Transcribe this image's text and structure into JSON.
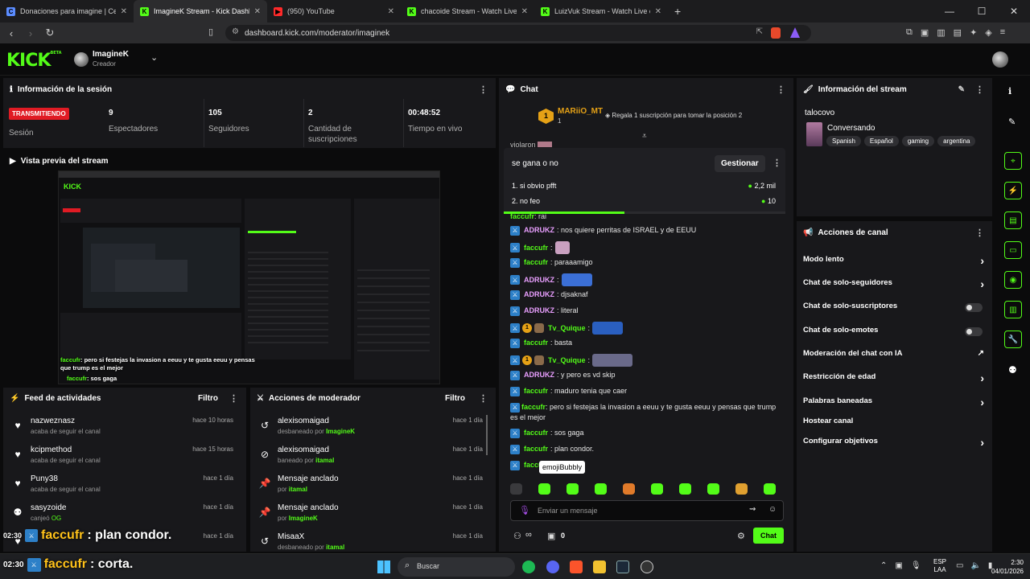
{
  "browser": {
    "tabs": [
      {
        "title": "Donaciones para imagine | Ceneka",
        "icon": "ceneka-icon",
        "color": "#5b8cff"
      },
      {
        "title": "ImagineK Stream - Kick Dashb",
        "icon": "kick-icon",
        "color": "#53fc18",
        "active": true
      },
      {
        "title": "(950) YouTube",
        "icon": "youtube-icon",
        "color": "#ff2a2a"
      },
      {
        "title": "chacoide Stream - Watch Live on",
        "icon": "kick-icon",
        "color": "#53fc18"
      },
      {
        "title": "LuizVuk Stream - Watch Live on",
        "icon": "kick-icon",
        "color": "#53fc18"
      }
    ],
    "new_tab": "+",
    "url": "dashboard.kick.com/moderator/imaginek"
  },
  "header": {
    "logo": "KICK",
    "logo_badge": "BETA",
    "channel_name": "ImagineK",
    "channel_role": "Creador"
  },
  "session": {
    "title": "Información de la sesión",
    "live_badge": "TRANSMITIENDO",
    "session_label": "Sesión",
    "stats": [
      {
        "value": "9",
        "label": "Espectadores"
      },
      {
        "value": "105",
        "label": "Seguidores"
      },
      {
        "value": "2",
        "label": "Cantidad de suscripciones"
      },
      {
        "value": "00:48:52",
        "label": "Tiempo en vivo"
      }
    ]
  },
  "preview": {
    "title": "Vista previa del stream",
    "caption_user": "faccufr",
    "caption_text": ": pero si festejas la invasion a eeuu y te gusta eeuu y pensas que trump es el mejor",
    "caption_user2": "faccufr",
    "caption_text2": ": sos gaga"
  },
  "activity": {
    "title": "Feed de actividades",
    "filter": "Filtro",
    "items": [
      {
        "name": "nazweznasz",
        "sub": "acaba de seguir el canal",
        "time": "hace 10 horas",
        "icon": "heart-icon"
      },
      {
        "name": "kcipmethod",
        "sub": "acaba de seguir el canal",
        "time": "hace 15 horas",
        "icon": "heart-icon"
      },
      {
        "name": "Puny38",
        "sub": "acaba de seguir el canal",
        "time": "hace 1 día",
        "icon": "heart-icon"
      },
      {
        "name": "sasyzoide",
        "sub_prefix": "canjeó",
        "sub_green": "OG",
        "time": "hace 1 día",
        "icon": "points-icon"
      },
      {
        "name": "",
        "sub": "",
        "time": "hace 1 día",
        "icon": "heart-icon"
      }
    ]
  },
  "modactions": {
    "title": "Acciones de moderador",
    "filter": "Filtro",
    "items": [
      {
        "name": "alexisomaigad",
        "sub": "desbaneado por",
        "by": "ImagineK",
        "time": "hace 1 día",
        "icon": "undo-icon"
      },
      {
        "name": "alexisomaigad",
        "sub": "baneado por",
        "by": "itamal",
        "time": "hace 1 día",
        "icon": "ban-icon"
      },
      {
        "name": "Mensaje anclado",
        "sub": "por",
        "by": "itamal",
        "time": "hace 1 día",
        "icon": "pin-icon"
      },
      {
        "name": "Mensaje anclado",
        "sub": "por",
        "by": "ImagineK",
        "time": "hace 1 día",
        "icon": "pin-icon"
      },
      {
        "name": "MisaaX",
        "sub": "desbaneado por",
        "by": "itamal",
        "time": "hace 1 día",
        "icon": "undo-icon"
      }
    ]
  },
  "chat": {
    "title": "Chat",
    "top_gifter": "MARiiO_MT",
    "top_gifter_rank": "1",
    "top_gifter_count": "1",
    "gift_cta": "Regala 1 suscripción para tomar la posición 2",
    "poll": {
      "question": "se gana o no",
      "manage": "Gestionar",
      "options": [
        {
          "label": "1. si obvio pfft",
          "value": "2,2 mil"
        },
        {
          "label": "2. no feo",
          "value": "10"
        }
      ]
    },
    "messages": [
      {
        "user": "ADRUKZ",
        "color": "pink",
        "text": ": nos quiere perritas de ISRAEL y de EEUU"
      },
      {
        "user": "faccufr",
        "color": "green",
        "text": ":",
        "emote": "#c9a0c0",
        "emote_w": 18
      },
      {
        "user": "faccufr",
        "color": "green",
        "text": ": paraaamigo"
      },
      {
        "user": "ADRUKZ",
        "color": "pink",
        "text": ":",
        "emote": "#3b6fd6",
        "emote_w": 38
      },
      {
        "user": "ADRUKZ",
        "color": "pink",
        "text": ": djsaknaf"
      },
      {
        "user": "ADRUKZ",
        "color": "pink",
        "text": ": literal"
      },
      {
        "user": "Tv_Quique",
        "color": "green",
        "sub": true,
        "text": ":",
        "emote": "#2a5fc0",
        "emote_w": 38
      },
      {
        "user": "faccufr",
        "color": "green",
        "text": ": basta"
      },
      {
        "user": "Tv_Quique",
        "color": "green",
        "sub": true,
        "text": ":",
        "emote": "#6a6a8a",
        "emote_w": 50
      },
      {
        "user": "ADRUKZ",
        "color": "pink",
        "text": ": y pero es vd skip"
      },
      {
        "user": "faccufr",
        "color": "green",
        "text": ": maduro tenia que caer"
      },
      {
        "user": "faccufr",
        "color": "green",
        "text": ": pero si festejas la invasion a eeuu y te gusta eeuu y pensas que trump es el mejor",
        "wrap": true
      },
      {
        "user": "faccufr",
        "color": "green",
        "text": ": sos gaga"
      },
      {
        "user": "faccufr",
        "color": "green",
        "text": ": plan condor."
      },
      {
        "user": "faccufr",
        "color": "green",
        "text": ""
      }
    ],
    "tooltip": "emojiBubbly",
    "input_placeholder": "Enviar un mensaje",
    "points": "0",
    "send": "Chat"
  },
  "stream_info": {
    "title": "Información del stream",
    "stream_title": "talocovo",
    "category": "Conversando",
    "tags": [
      "Spanish",
      "Español",
      "gaming",
      "argentina"
    ]
  },
  "channel_actions": {
    "title": "Acciones de canal",
    "items": [
      {
        "label": "Modo lento",
        "control": "arrow"
      },
      {
        "label": "Chat de solo-seguidores",
        "control": "arrow"
      },
      {
        "label": "Chat de solo-suscriptores",
        "control": "toggle"
      },
      {
        "label": "Chat de solo-emotes",
        "control": "toggle"
      },
      {
        "label": "Moderación del chat con IA",
        "control": "external"
      },
      {
        "label": "Restricción de edad",
        "control": "arrow"
      },
      {
        "label": "Palabras baneadas",
        "control": "arrow"
      },
      {
        "label": "Hostear canal",
        "control": "none"
      },
      {
        "label": "Configurar objetivos",
        "control": "arrow"
      }
    ]
  },
  "overlay": {
    "time1": "02:30",
    "line1_user": "faccufr",
    "line1_text": ": plan condor.",
    "time2": "02:30",
    "line2_user": "faccufr",
    "line2_text": ": corta."
  },
  "taskbar": {
    "search": "Buscar",
    "lang1": "ESP",
    "lang2": "LAA",
    "time": "2:30",
    "date": "04/01/2026"
  }
}
